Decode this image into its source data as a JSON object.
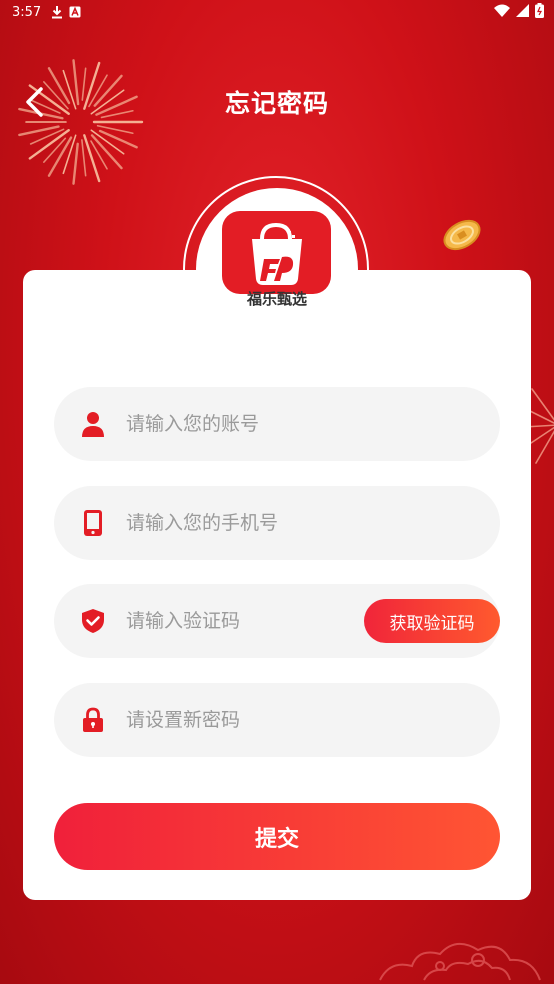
{
  "status_bar": {
    "time": "3:57",
    "icons": [
      "download-icon",
      "a-notification-icon",
      "wifi-icon",
      "signal-icon",
      "battery-icon"
    ]
  },
  "header": {
    "title": "忘记密码",
    "back_icon": "chevron-left-icon"
  },
  "brand": {
    "name": "福乐甄选",
    "logo_icon": "shopping-bag-logo-icon"
  },
  "form": {
    "account": {
      "placeholder": "请输入您的账号",
      "value": "",
      "icon": "user-icon"
    },
    "phone": {
      "placeholder": "请输入您的手机号",
      "value": "",
      "icon": "phone-icon"
    },
    "code": {
      "placeholder": "请输入验证码",
      "value": "",
      "icon": "shield-check-icon",
      "button_label": "获取验证码"
    },
    "new_password": {
      "placeholder": "请设置新密码",
      "value": "",
      "icon": "lock-icon"
    },
    "submit_label": "提交"
  },
  "colors": {
    "accent": "#e31d25",
    "background": "#cf1118",
    "button_gradient_start": "#f0203a",
    "button_gradient_end": "#ff5533",
    "field_bg": "#f4f4f4",
    "placeholder": "#9a9a9a"
  }
}
